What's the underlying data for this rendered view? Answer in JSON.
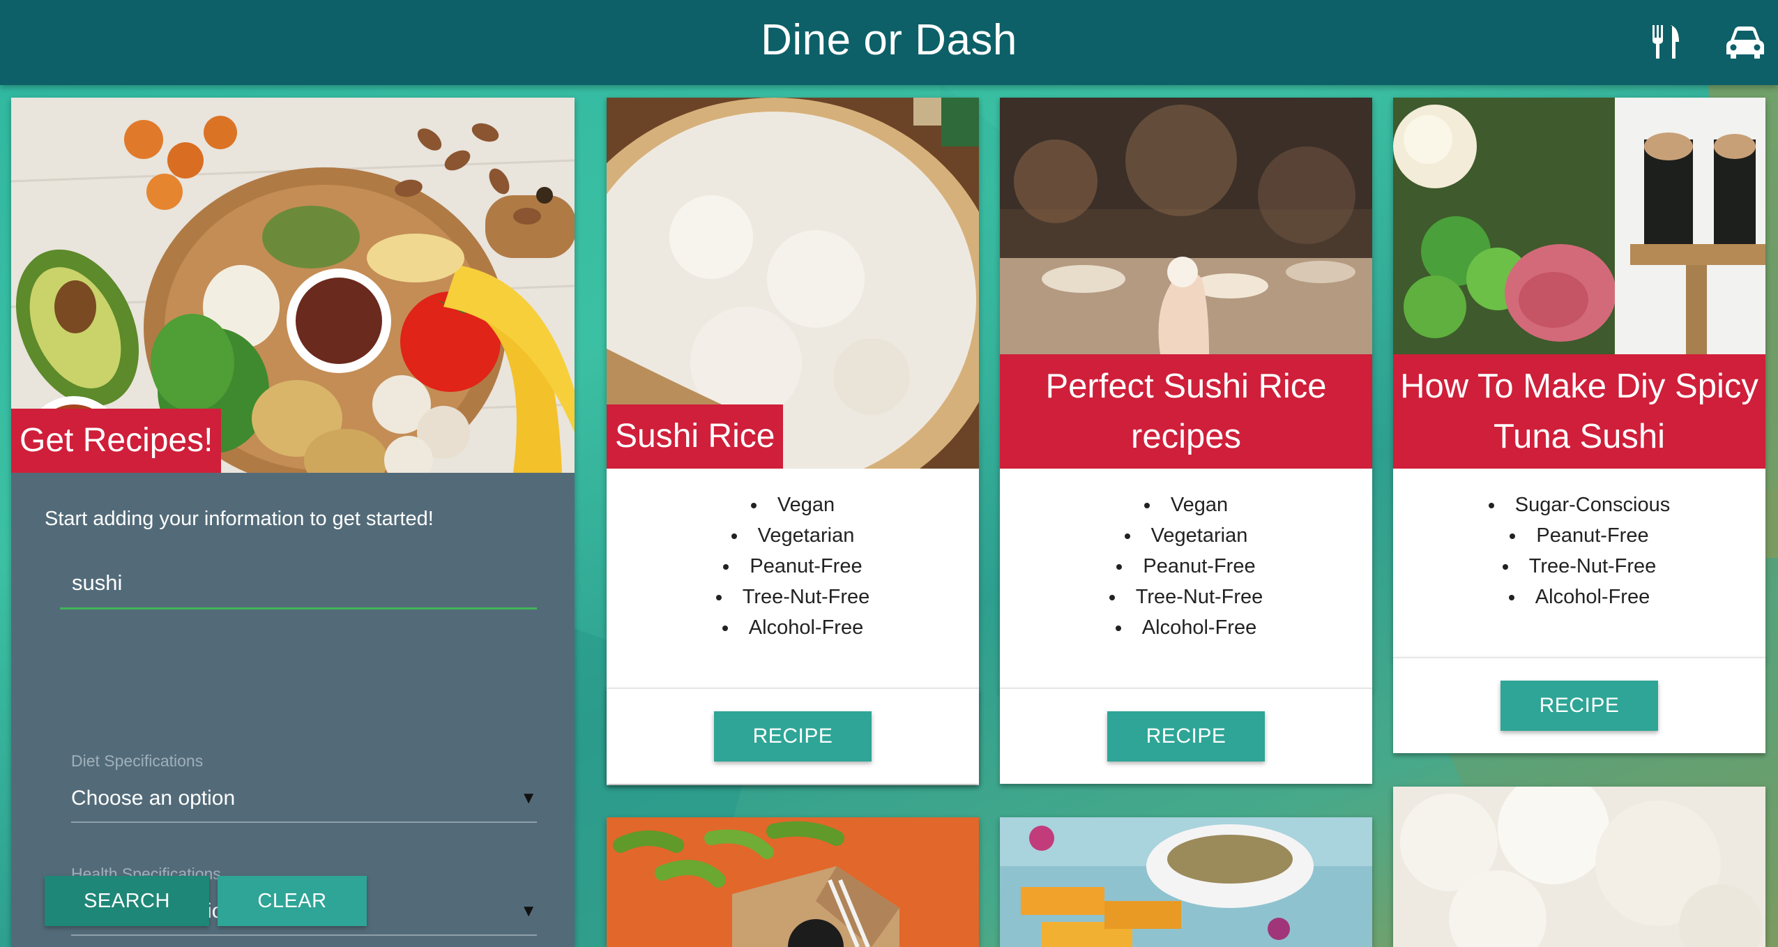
{
  "app": {
    "title": "Dine or Dash"
  },
  "nav": {
    "dine_icon": "fork-knife-icon",
    "dash_icon": "car-icon"
  },
  "search_panel": {
    "title": "Get Recipes!",
    "intro": "Start adding your information to get started!",
    "query_value": "sushi",
    "diet": {
      "label": "Diet Specifications",
      "selected": "Choose an option"
    },
    "health": {
      "label": "Health Specifications",
      "selected": "Choose an option"
    },
    "search_label": "SEARCH",
    "clear_label": "CLEAR"
  },
  "recipes": [
    {
      "title": "Sushi Rice",
      "tags": [
        "Vegan",
        "Vegetarian",
        "Peanut-Free",
        "Tree-Nut-Free",
        "Alcohol-Free"
      ],
      "button": "RECIPE"
    },
    {
      "title": "Perfect Sushi Rice recipes",
      "tags": [
        "Vegan",
        "Vegetarian",
        "Peanut-Free",
        "Tree-Nut-Free",
        "Alcohol-Free"
      ],
      "button": "RECIPE"
    },
    {
      "title": "How To Make Diy Spicy Tuna Sushi",
      "tags": [
        "Sugar-Conscious",
        "Peanut-Free",
        "Tree-Nut-Free",
        "Alcohol-Free"
      ],
      "button": "RECIPE"
    }
  ],
  "colors": {
    "navbar": "#0d6068",
    "panel": "#536b79",
    "title_red": "#cf1f3a",
    "button_teal": "#2ea596",
    "search_button": "#1f8777",
    "input_underline": "#41b45a"
  }
}
